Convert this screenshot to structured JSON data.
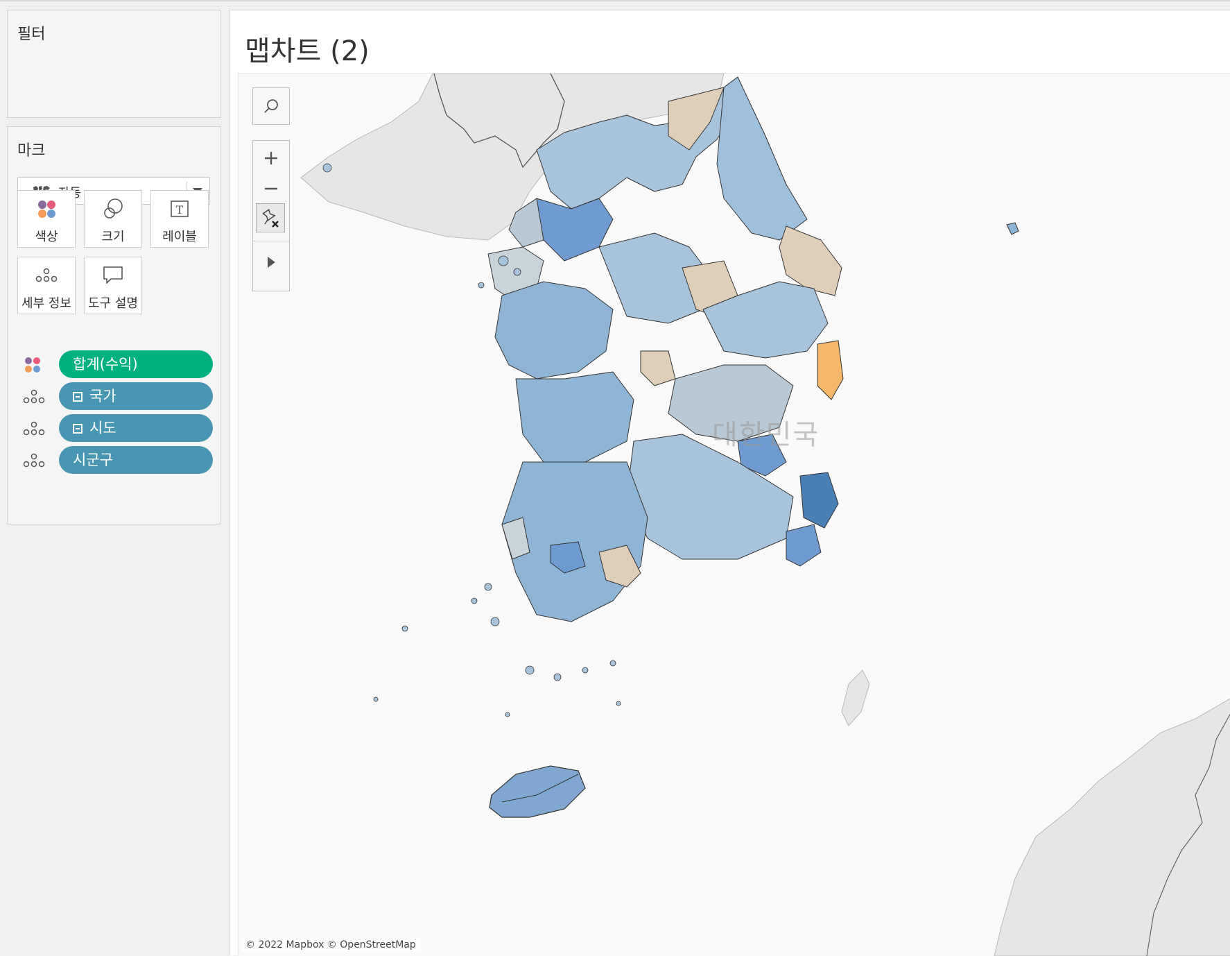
{
  "filters": {
    "title": "필터"
  },
  "marks": {
    "title": "마크",
    "mark_type": {
      "label": "자동",
      "icon": "map-icon"
    },
    "buttons": [
      {
        "label": "색상",
        "icon": "color-dots-icon"
      },
      {
        "label": "크기",
        "icon": "size-circles-icon"
      },
      {
        "label": "레이블",
        "icon": "label-text-icon"
      },
      {
        "label": "세부 정보",
        "icon": "detail-dots-icon"
      },
      {
        "label": "도구 설명",
        "icon": "tooltip-icon"
      }
    ],
    "pills": [
      {
        "label": "합계(수익)",
        "type": "color",
        "color": "#00b180",
        "collapsible": false
      },
      {
        "label": "국가",
        "type": "detail",
        "color": "#4996b2",
        "collapsible": true
      },
      {
        "label": "시도",
        "type": "detail",
        "color": "#4996b2",
        "collapsible": true
      },
      {
        "label": "시군구",
        "type": "detail",
        "color": "#4996b2",
        "collapsible": false
      }
    ]
  },
  "sheet": {
    "title": "맵차트 (2)",
    "map": {
      "country_label": "대한민국",
      "attribution": "© 2022 Mapbox © OpenStreetMap",
      "controls": [
        "search-icon",
        "zoom-in-icon",
        "zoom-out-icon",
        "pin-map-icon",
        "expand-arrow-icon"
      ],
      "colors": {
        "low": "#4a7fb5",
        "mid_low": "#8fb5d6",
        "neutral": "#c9d3da",
        "mid_high": "#e0cfb8",
        "high": "#f6b76a",
        "land_background": "#e3e3e3",
        "sea": "#fafafa"
      }
    }
  }
}
